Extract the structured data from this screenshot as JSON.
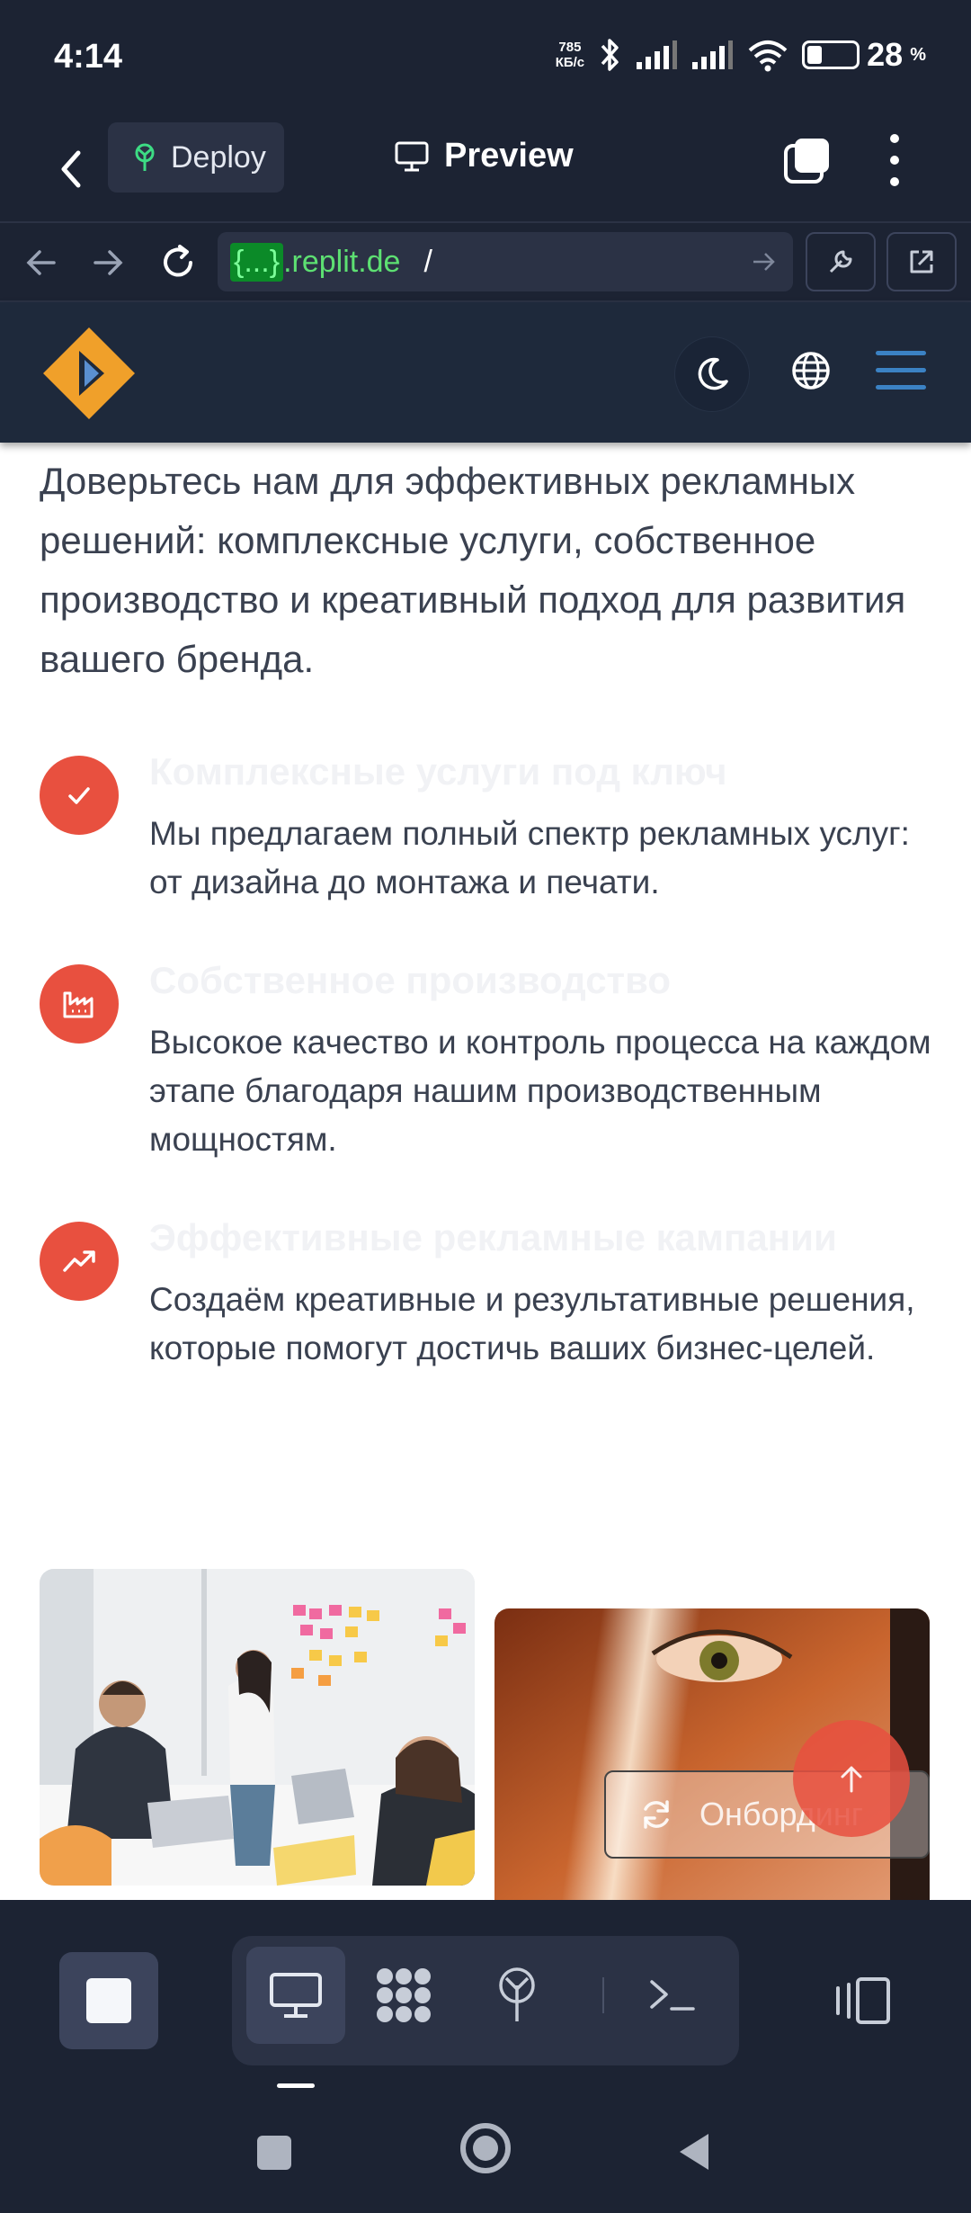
{
  "status_bar": {
    "time": "4:14",
    "net_speed_value": "785",
    "net_speed_unit": "КБ/с",
    "battery_level": "28",
    "battery_pct_sign": "%"
  },
  "app_header": {
    "deploy_label": "Deploy",
    "preview_label": "Preview"
  },
  "browser": {
    "url_highlight": "{...}",
    "url_domain": ".replit.de",
    "url_path": "/"
  },
  "site": {
    "intro": "Доверьтесь нам для эффективных рекламных решений: комплексные услуги, собственное производство и креативный подход для развития вашего бренда.",
    "features": [
      {
        "title": "Комплексные услуги под ключ",
        "description": "Мы предлагаем полный спектр рекламных услуг: от дизайна до монтажа и печати.",
        "icon": "check-icon"
      },
      {
        "title": "Собственное производство",
        "description": "Высокое качество и контроль процесса на каждом этапе благодаря нашим производственным мощностям.",
        "icon": "factory-icon"
      },
      {
        "title": "Эффективные рекламные кампании",
        "description": "Создаём креативные и результативные решения, которые помогут достичь ваших бизнес-целей.",
        "icon": "trending-up-icon"
      }
    ],
    "onboarding_label": "Онбординг"
  },
  "colors": {
    "accent": "#e8503f",
    "header_bg": "#1e293b",
    "replit_bg": "#1c2333"
  }
}
